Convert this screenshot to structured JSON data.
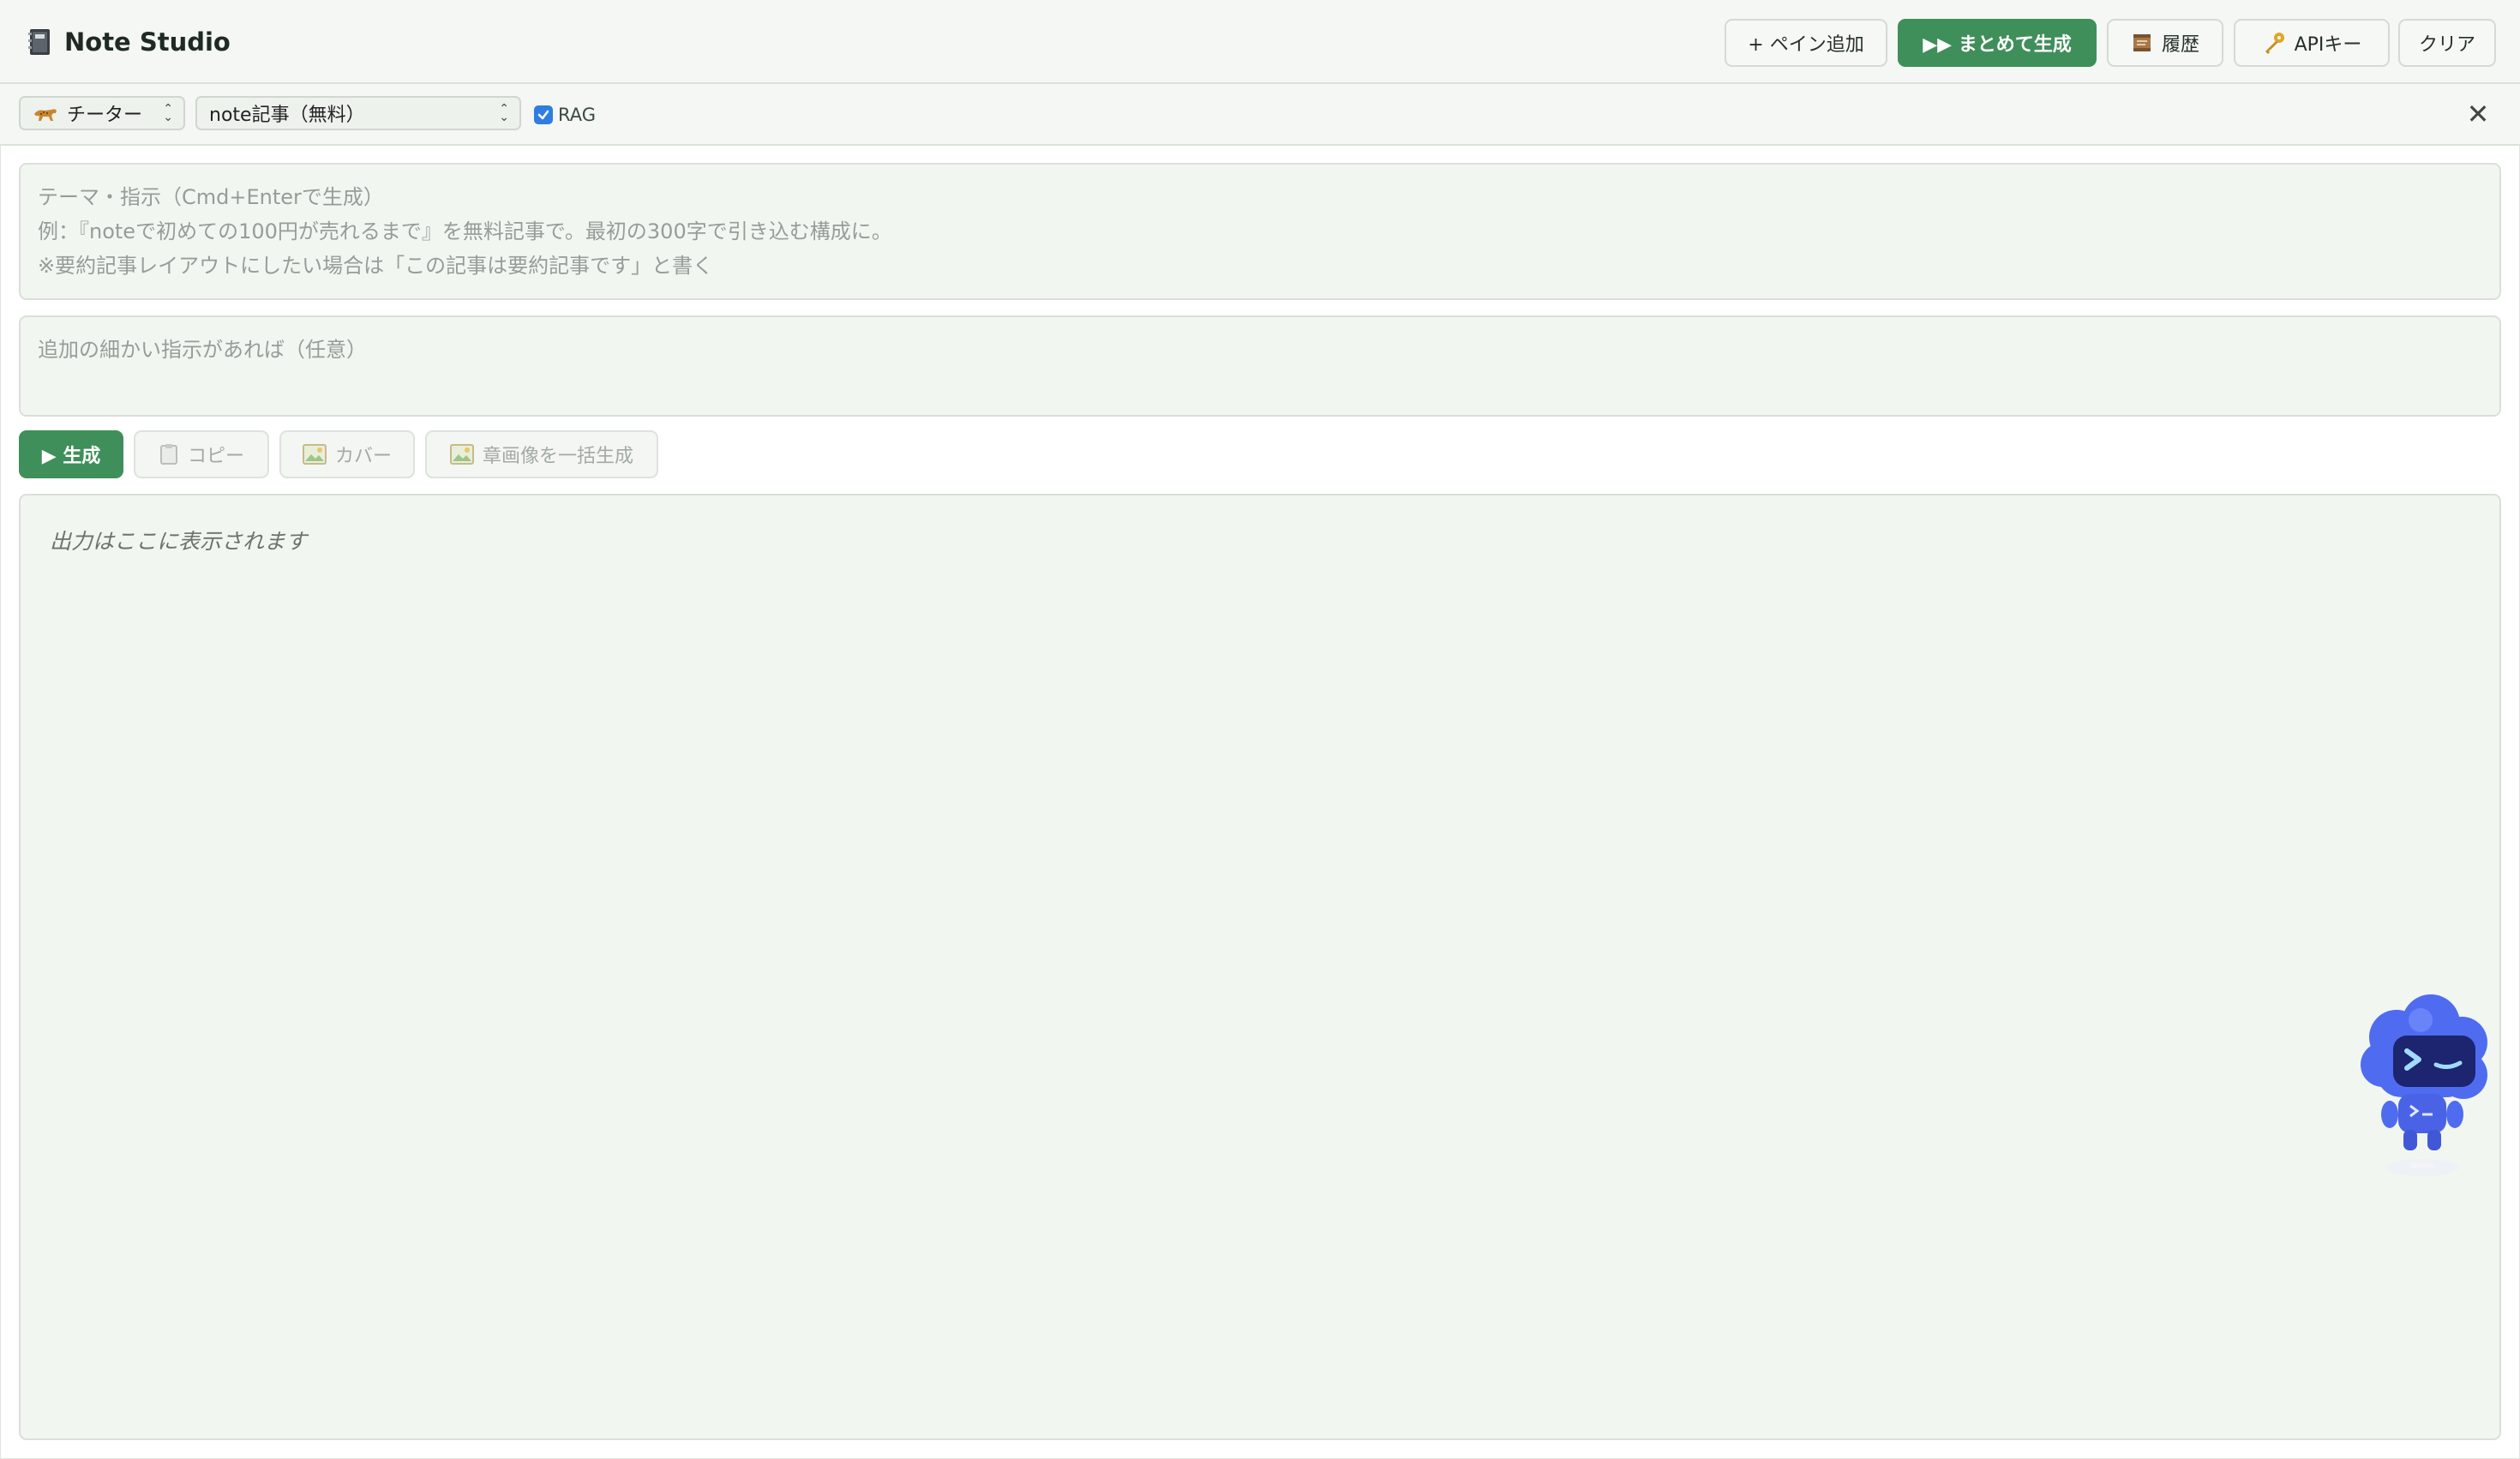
{
  "app": {
    "title": "Note Studio",
    "logo_icon": "notebook-icon"
  },
  "header": {
    "add_pane": {
      "icon": "plus-icon",
      "label": "+ ペイン追加"
    },
    "bulk_generate": {
      "icon": "fast-forward-icon",
      "label": "▶▶ まとめて生成"
    },
    "history": {
      "icon": "scroll-icon",
      "label": "履歴"
    },
    "api_key": {
      "icon": "key-icon",
      "label": "APIキー"
    },
    "clear": {
      "label": "クリア"
    }
  },
  "toolbar": {
    "model_select": {
      "icon": "cheetah-icon",
      "value": "チーター"
    },
    "type_select": {
      "value": "note記事（無料）"
    },
    "rag": {
      "label": "RAG",
      "checked": true
    },
    "close_icon": "close-icon"
  },
  "prompt": {
    "placeholder_lines": [
      "テーマ・指示（Cmd+Enterで生成）",
      "例：『noteで初めての100円が売れるまで』を無料記事で。最初の300字で引き込む構成に。",
      "※要約記事レイアウトにしたい場合は「この記事は要約記事です」と書く"
    ]
  },
  "extra": {
    "placeholder": "追加の細かい指示があれば（任意）"
  },
  "actions": {
    "generate": "▶ 生成",
    "copy": {
      "icon": "clipboard-icon",
      "label": "コピー"
    },
    "cover": {
      "icon": "image-icon",
      "label": "カバー"
    },
    "chapter_images": {
      "icon": "image-icon",
      "label": "章画像を一括生成"
    }
  },
  "output": {
    "placeholder": "出力はここに表示されます"
  },
  "mascot": {
    "icon": "robot-mascot-icon"
  },
  "colors": {
    "primary": "#3f8f5a",
    "background": "#f2f6f1",
    "checkbox": "#2f7de1",
    "mascot": "#4f6cf0"
  }
}
